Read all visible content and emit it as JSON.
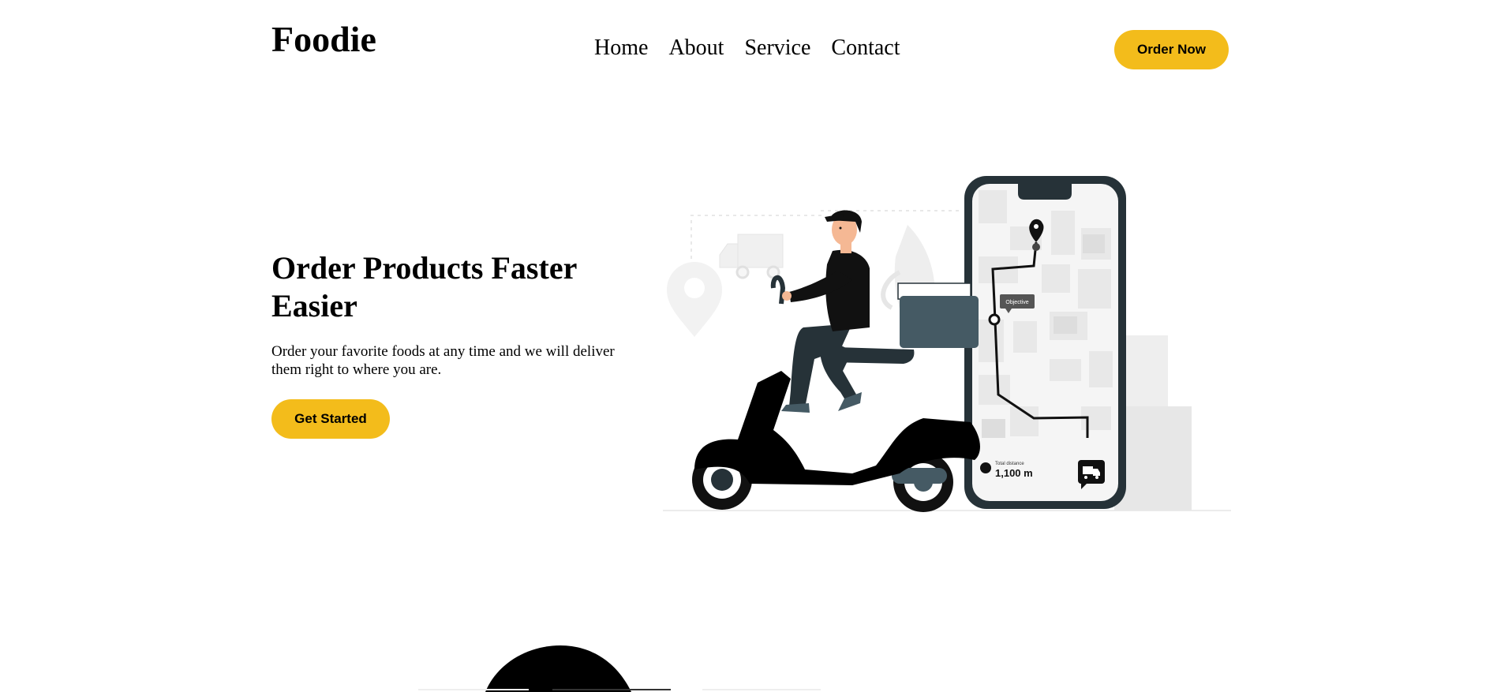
{
  "header": {
    "logo": "Foodie",
    "nav": [
      "Home",
      "About",
      "Service",
      "Contact"
    ],
    "order_button": "Order Now"
  },
  "hero": {
    "title": "Order Products Faster Easier",
    "description": "Order your favorite foods at any time and we will deliver them right to where you are.",
    "cta": "Get Started"
  },
  "illustration": {
    "map_bubble": "Objective",
    "distance_label": "Total distance",
    "distance_value": "1,100 m"
  },
  "colors": {
    "accent": "#f3bc1b",
    "dark": "#263238",
    "box": "#455a64",
    "light_grey": "#f0f0f0"
  }
}
